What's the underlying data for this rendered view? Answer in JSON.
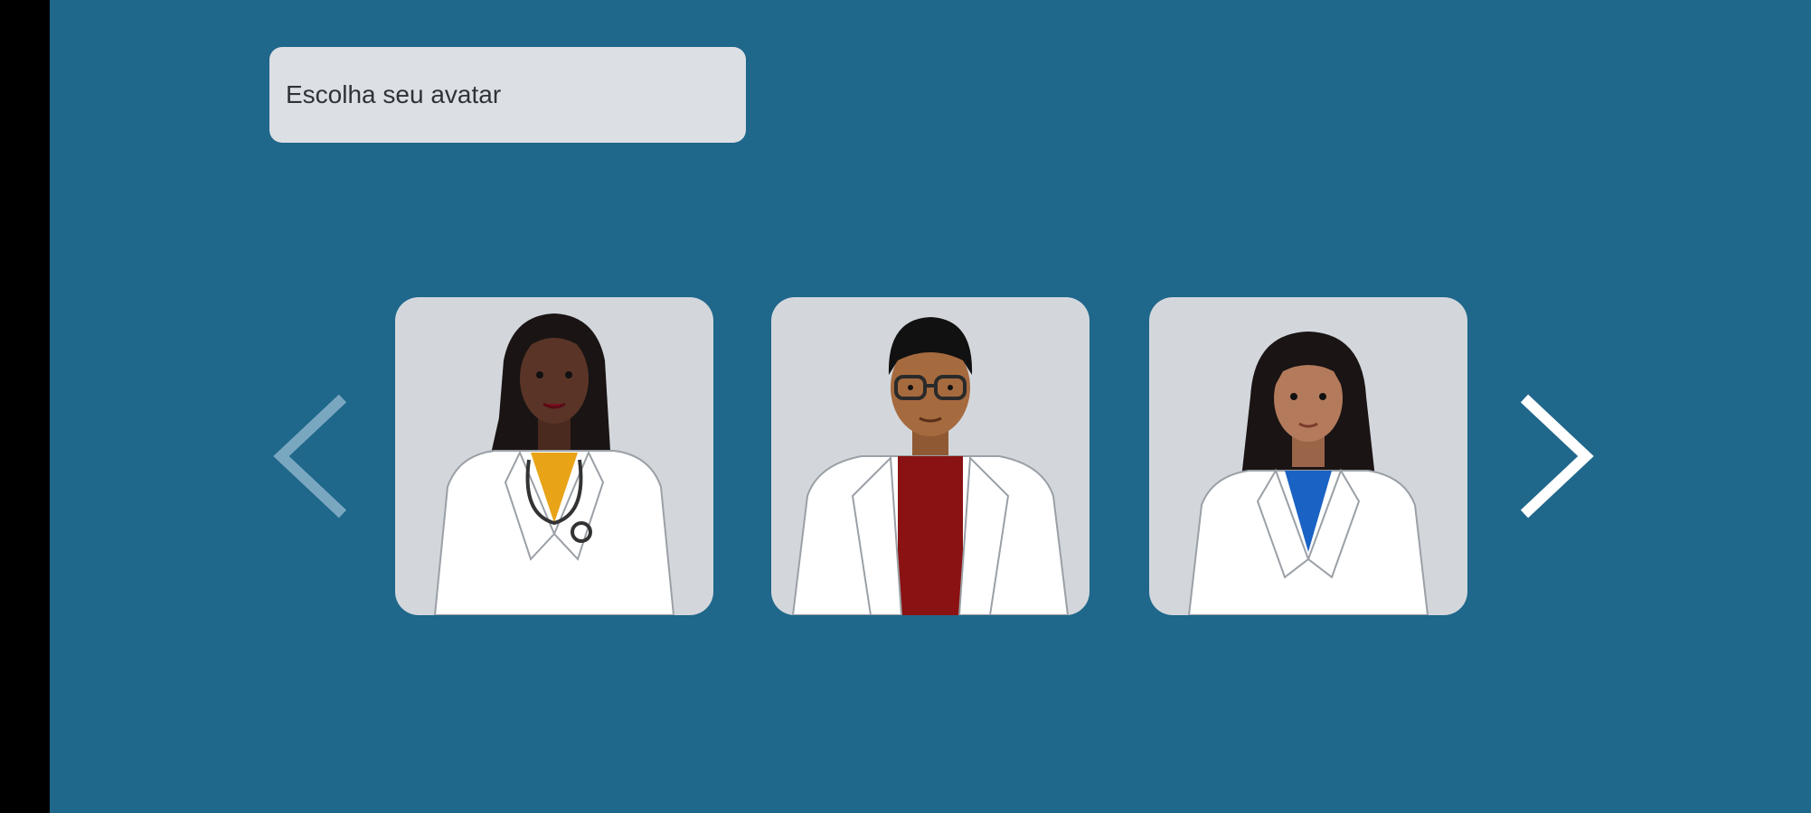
{
  "header": {
    "title": "Escolha seu avatar"
  },
  "carousel": {
    "prev_icon": "chevron-left-icon",
    "next_icon": "chevron-right-icon",
    "avatars": [
      {
        "id": "avatar-1",
        "skin": "#5a3527",
        "hair": "#1a1414",
        "shirt": "#e8a317",
        "accessory": "stethoscope"
      },
      {
        "id": "avatar-2",
        "skin": "#a66a3f",
        "hair": "#111111",
        "shirt": "#8a1212",
        "accessory": "glasses"
      },
      {
        "id": "avatar-3",
        "skin": "#b37a5c",
        "hair": "#1a1414",
        "shirt": "#1a62c4",
        "accessory": "none"
      }
    ]
  },
  "colors": {
    "background": "#1f678b",
    "card": "#d3d7dc",
    "title_box": "#dcdfe3",
    "coat": "#ffffff"
  }
}
